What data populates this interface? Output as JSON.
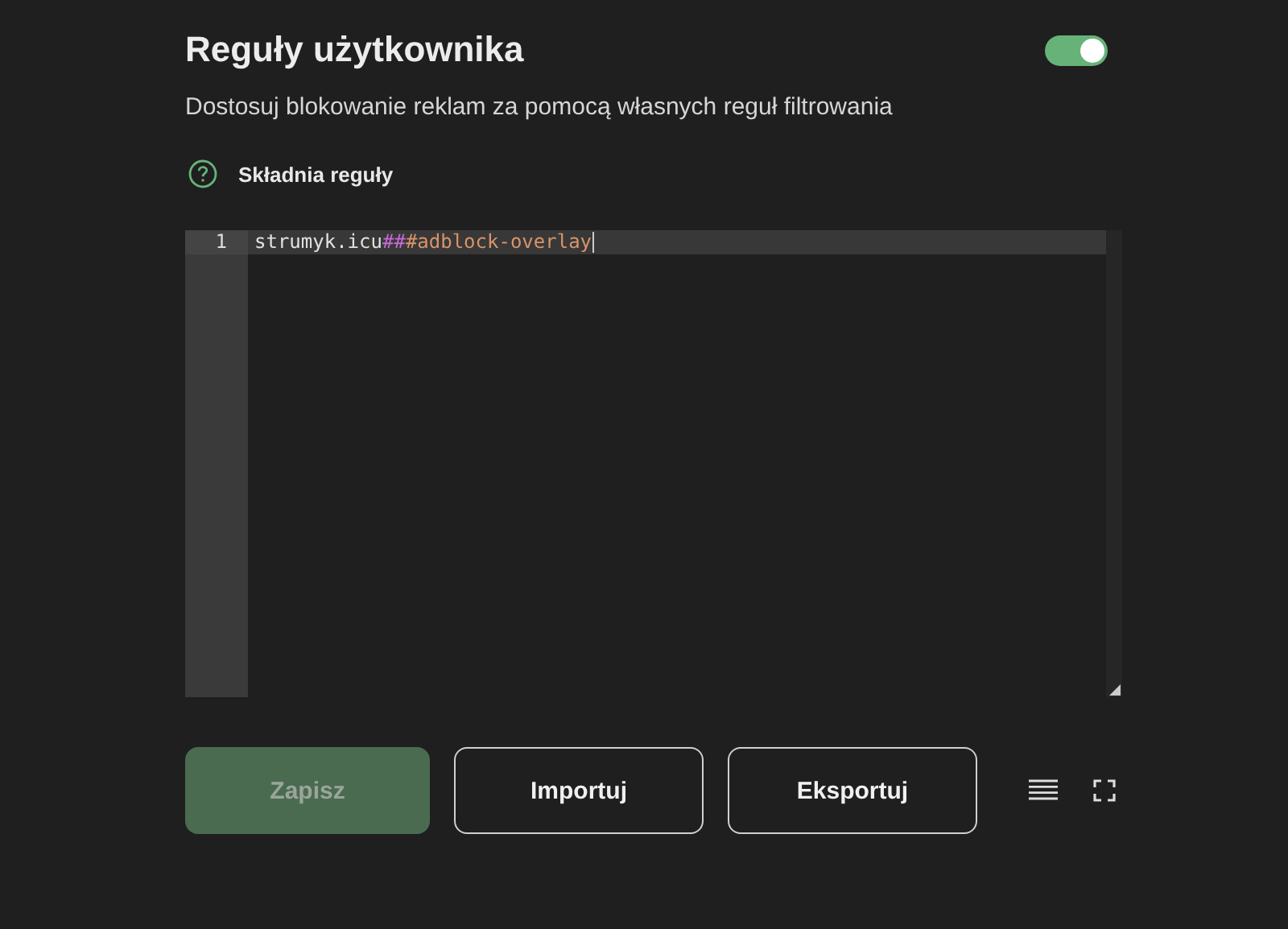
{
  "header": {
    "title": "Reguły użytkownika",
    "enabled": true,
    "description": "Dostosuj blokowanie reklam za pomocą własnych reguł filtrowania"
  },
  "help_link": {
    "label": "Składnia reguły"
  },
  "editor": {
    "lines": [
      {
        "number": "1",
        "active": true,
        "tokens": [
          {
            "kind": "domain",
            "text": "strumyk.icu"
          },
          {
            "kind": "separator",
            "text": "##"
          },
          {
            "kind": "selector",
            "text": "#adblock-overlay"
          }
        ]
      }
    ]
  },
  "buttons": [
    {
      "label": "Zapisz",
      "kind": "primary",
      "disabled": true
    },
    {
      "label": "Importuj",
      "kind": "outline",
      "disabled": false
    },
    {
      "label": "Eksportuj",
      "kind": "outline",
      "disabled": false
    }
  ]
}
